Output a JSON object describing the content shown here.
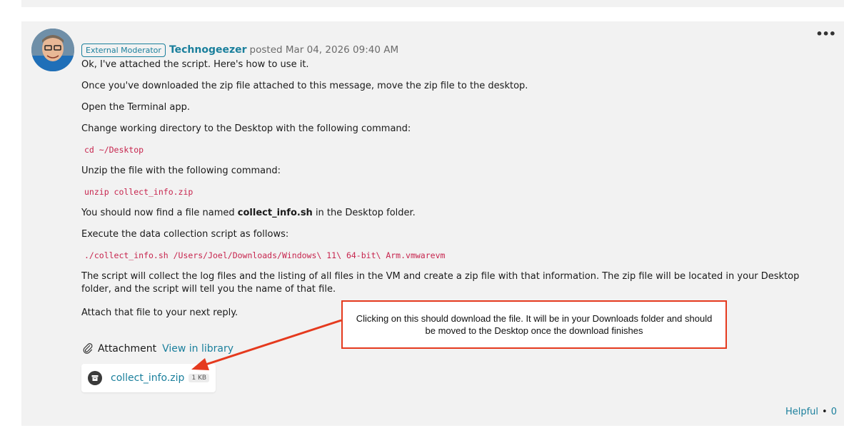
{
  "post": {
    "badge": "External Moderator",
    "author": "Technogeezer",
    "posted": "posted Mar 04, 2026 09:40 AM",
    "more_label": "•••",
    "paragraphs": {
      "p1": "Ok, I've attached the script. Here's how to use it.",
      "p2": "Once you've downloaded the zip file attached to this message, move the zip file to the desktop.",
      "p3": "Open the Terminal app.",
      "p4": "Change working directory to the Desktop with the following command:",
      "code1": "cd ~/Desktop",
      "p5": "Unzip the file with the following command:",
      "code2": "unzip collect_info.zip",
      "p6_before": "You should now find a file named ",
      "p6_bold": "collect_info.sh",
      "p6_after": " in the Desktop folder.",
      "p7": "Execute the data collection script as follows:",
      "code3": "./collect_info.sh /Users/Joel/Downloads/Windows\\ 11\\ 64-bit\\ Arm.vmwarevm",
      "p8": "The script will collect the log files and the listing of all files in the VM and create a zip file with that information. The zip file will be located in your Desktop folder, and the script will tell you the name of that file.",
      "p9": "Attach that file to your next reply."
    },
    "attachment": {
      "label": "Attachment",
      "view_library": "View in library",
      "file_name": "collect_info.zip",
      "file_size": "1 KB"
    },
    "helpful_label": "Helpful",
    "helpful_sep": "•",
    "helpful_count": "0"
  },
  "annotation": {
    "text": "Clicking on this should download the file. It will be in your Downloads folder and should be moved to the Desktop once the download finishes",
    "color": "#e53a1e"
  },
  "colors": {
    "link": "#1a7f9c",
    "code": "#c7254e",
    "card_bg": "#f2f2f2"
  }
}
